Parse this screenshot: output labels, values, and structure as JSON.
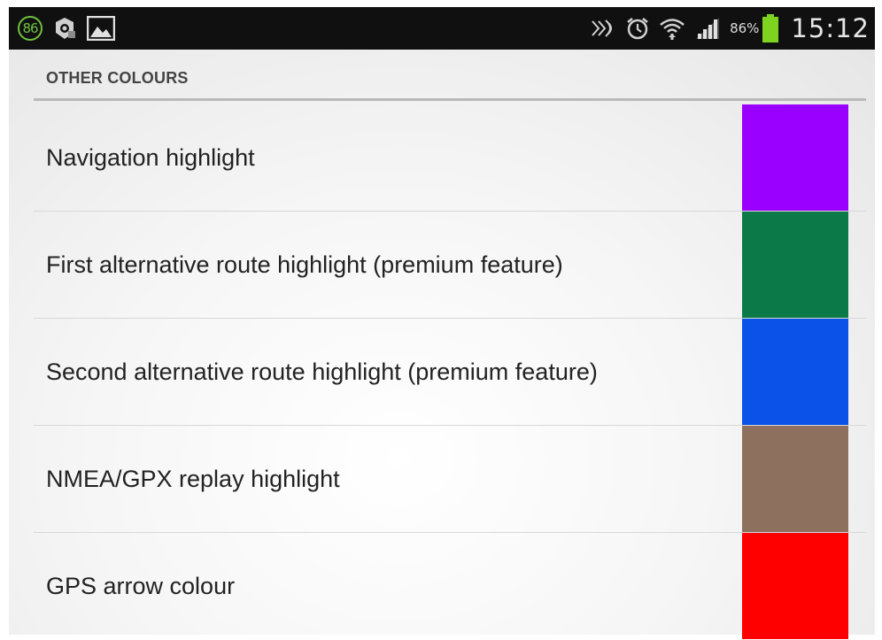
{
  "status_bar": {
    "notification_count": "86",
    "icons": [
      "notification-86-icon",
      "android-settings-icon",
      "picture-icon",
      "nfc-icon",
      "alarm-clock-icon",
      "wifi-icon",
      "signal-icon",
      "battery-icon"
    ],
    "battery_percent": "86%",
    "time": "15:12",
    "colors": {
      "background": "#101010",
      "accent": "#7ed321"
    }
  },
  "section": {
    "title": "OTHER COLOURS"
  },
  "preferences": [
    {
      "label": "Navigation highlight",
      "color": "#9900ff"
    },
    {
      "label": "First alternative route highlight (premium feature)",
      "color": "#0b7a48"
    },
    {
      "label": "Second alternative route highlight (premium feature)",
      "color": "#0a52e8"
    },
    {
      "label": "NMEA/GPX replay highlight",
      "color": "#8e705e"
    },
    {
      "label": "GPS arrow colour",
      "color": "#ff0000"
    }
  ]
}
